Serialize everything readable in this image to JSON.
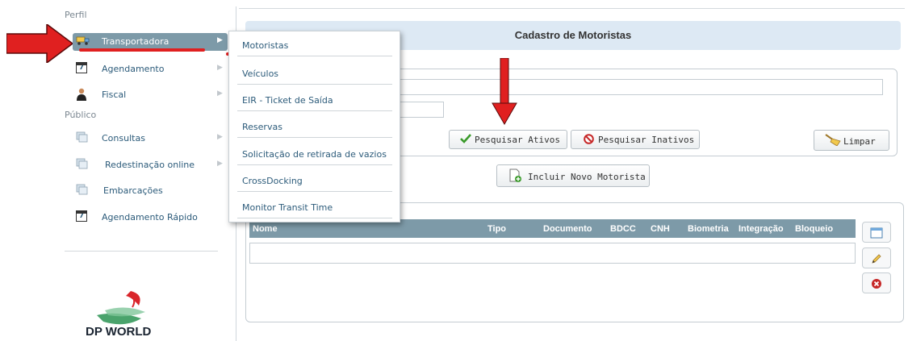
{
  "sidebar": {
    "section_profile": "Perfil",
    "section_public": "Público",
    "items": [
      {
        "label": "Transportadora",
        "icon": "truck-icon"
      },
      {
        "label": "Agendamento",
        "icon": "calendar-icon"
      },
      {
        "label": "Fiscal",
        "icon": "person-icon"
      },
      {
        "label": "Consultas",
        "icon": "documents-icon"
      },
      {
        "label": "Redestinação online",
        "icon": "documents-icon"
      },
      {
        "label": "Embarcações",
        "icon": "documents-icon"
      },
      {
        "label": "Agendamento Rápido",
        "icon": "calendar-icon"
      }
    ],
    "calendar_day": "7",
    "logo_text": "DP WORLD"
  },
  "dropdown": {
    "items": [
      "Motoristas",
      "Veículos",
      "EIR - Ticket de Saída",
      "Reservas",
      "Solicitação de retirada de vazios",
      "CrossDocking",
      "Monitor Transit Time"
    ]
  },
  "main": {
    "title": "Cadastro de Motoristas",
    "buttons": {
      "search_active": "Pesquisar Ativos",
      "search_inactive": "Pesquisar Inativos",
      "clear": "Limpar",
      "add_driver": "Incluir Novo Motorista"
    },
    "grid": {
      "columns": [
        "Nome",
        "Tipo",
        "Documento",
        "BDCC",
        "CNH",
        "Biometria",
        "Integração",
        "Bloqueio"
      ]
    }
  },
  "colors": {
    "active_menu": "#7d9aa8",
    "title_bar": "#dde9f4",
    "annotation_red": "#e02020",
    "link_text": "#2c5b7a"
  }
}
